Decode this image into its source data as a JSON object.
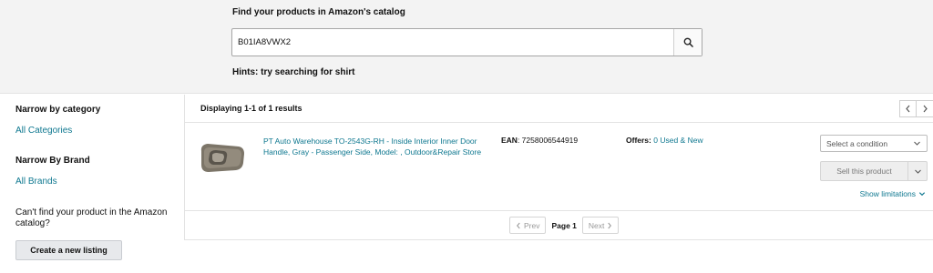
{
  "search": {
    "title": "Find your products in Amazon's catalog",
    "value": "B01IA8VWX2",
    "hint": "Hints: try searching for shirt"
  },
  "sidebar": {
    "category_heading": "Narrow by category",
    "category_link": "All Categories",
    "brand_heading": "Narrow By Brand",
    "brand_link": "All Brands",
    "cant_find_text": "Can't find your product in the Amazon catalog?",
    "create_listing_label": "Create a new listing"
  },
  "results": {
    "count_text": "Displaying 1-1 of 1 results",
    "items": [
      {
        "title": "PT Auto Warehouse TO-2543G-RH - Inside Interior Inner Door Handle, Gray - Passenger Side, Model: , Outdoor&Repair Store",
        "ean_label": "EAN",
        "ean_value": ": 7258006544919",
        "offers_label": "Offers:",
        "offers_link": "0 Used & New",
        "condition_placeholder": "Select a condition",
        "sell_label": "Sell this product",
        "limitations_label": "Show limitations"
      }
    ]
  },
  "pagination": {
    "prev_label": "Prev",
    "current_label": "Page 1",
    "next_label": "Next"
  },
  "colors": {
    "link": "#0f7890",
    "band_bg": "#f3f3f3",
    "button_bg": "#e7e9ec"
  }
}
